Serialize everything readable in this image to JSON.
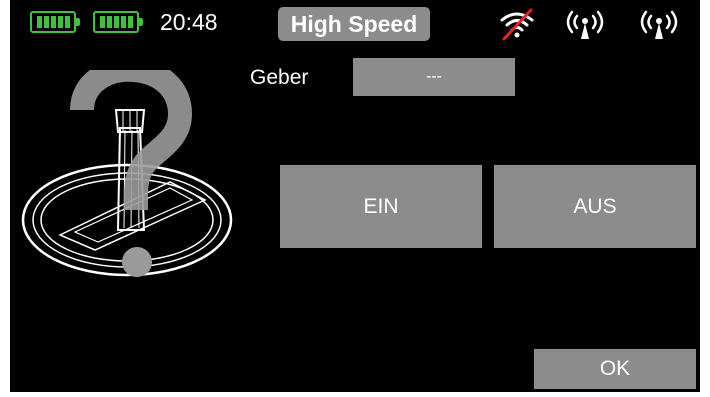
{
  "status_bar": {
    "battery_icons": [
      "battery-full-icon",
      "battery-full-icon"
    ],
    "time": "20:48",
    "mode": "High Speed",
    "signal_icons": [
      "telemetry-off-icon",
      "antenna-signal-icon",
      "antenna-signal-icon"
    ],
    "battery_color": "#3fc33f",
    "telemetry_off_color": "#e0261f"
  },
  "control": {
    "label": "Geber",
    "value": "---"
  },
  "buttons": {
    "on_label": "EIN",
    "off_label": "AUS",
    "ok_label": "OK"
  },
  "illustration": {
    "icon": "unknown-control-stick-icon"
  },
  "colors": {
    "background": "#000000",
    "button": "#8c8c8c",
    "text": "#ffffff"
  }
}
